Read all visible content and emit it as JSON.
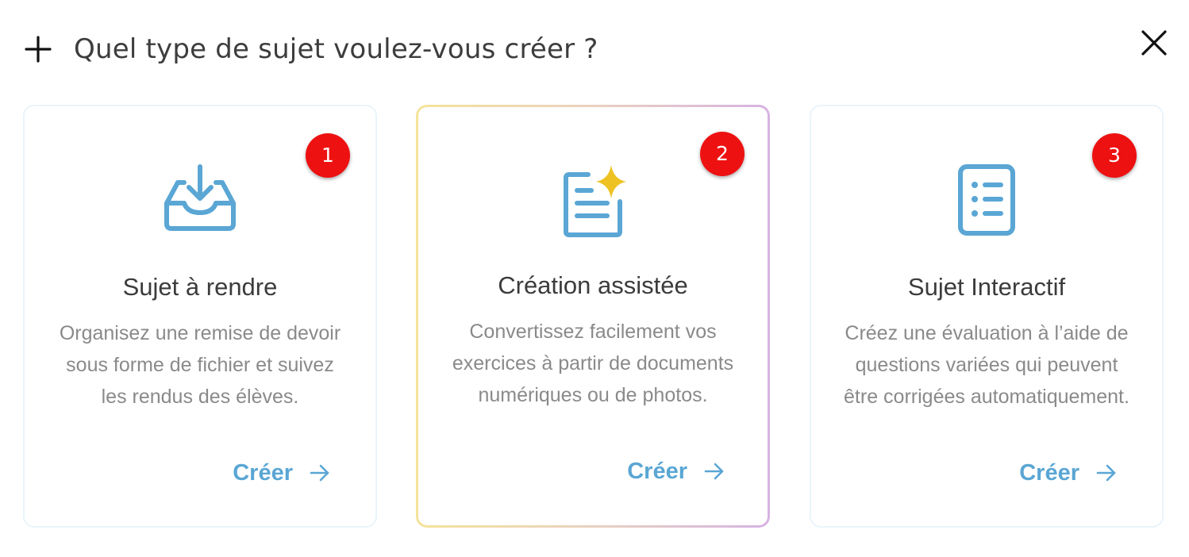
{
  "header": {
    "title": "Quel type de sujet voulez-vous créer ?",
    "plus_icon": "plus-icon",
    "close_icon": "close-icon"
  },
  "cards": [
    {
      "badge": "1",
      "icon": "inbox-download-icon",
      "title": "Sujet à rendre",
      "description": "Organisez une remise de devoir sous forme de fichier et suivez les rendus des élèves.",
      "action": "Créer"
    },
    {
      "badge": "2",
      "icon": "document-sparkle-icon",
      "title": "Création assistée",
      "description": "Convertissez facilement vos exercices à partir de documents numériques ou de photos.",
      "action": "Créer"
    },
    {
      "badge": "3",
      "icon": "checklist-icon",
      "title": "Sujet Interactif",
      "description": "Créez une évaluation à l’aide de questions variées qui peuvent être corrigées automatiquement.",
      "action": "Créer"
    }
  ],
  "colors": {
    "accent": "#5aa6d4",
    "badge": "#ee1111",
    "sparkle": "#eec222",
    "highlight_gradient_start": "#f5e39a",
    "highlight_gradient_end": "#d6b3e3"
  }
}
